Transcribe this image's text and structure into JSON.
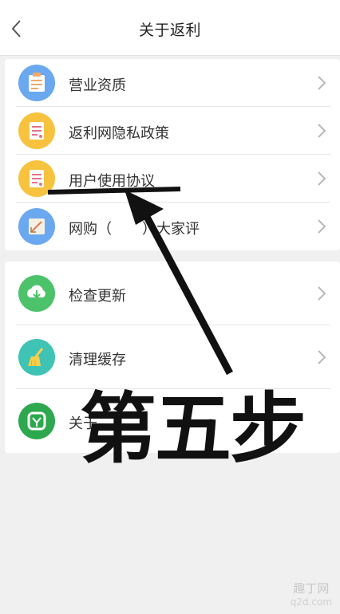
{
  "header": {
    "title": "关于返利",
    "back_icon": "chevron-left-icon"
  },
  "section1": [
    {
      "label": "营业资质",
      "icon": "license-icon",
      "color": "#6aa8f0"
    },
    {
      "label": "返利网隐私政策",
      "icon": "document-icon",
      "color": "#f7c33f"
    },
    {
      "label": "用户使用协议",
      "icon": "document-icon",
      "color": "#f7c33f"
    },
    {
      "label": "网购（",
      "label_end": "）大家评",
      "icon": "rating-icon",
      "color": "#6aa8f0"
    }
  ],
  "section2": [
    {
      "label": "检查更新",
      "icon": "cloud-download-icon",
      "color": "#4cc26a"
    },
    {
      "label": "清理缓存",
      "icon": "broom-icon",
      "color": "#3fc3b5"
    },
    {
      "label": "关于",
      "icon": "app-logo-icon",
      "color": "#2ea84e"
    }
  ],
  "annotation": {
    "text": "第五步"
  },
  "watermark": {
    "line1": "趣丁网",
    "line2": "q2d.com"
  }
}
